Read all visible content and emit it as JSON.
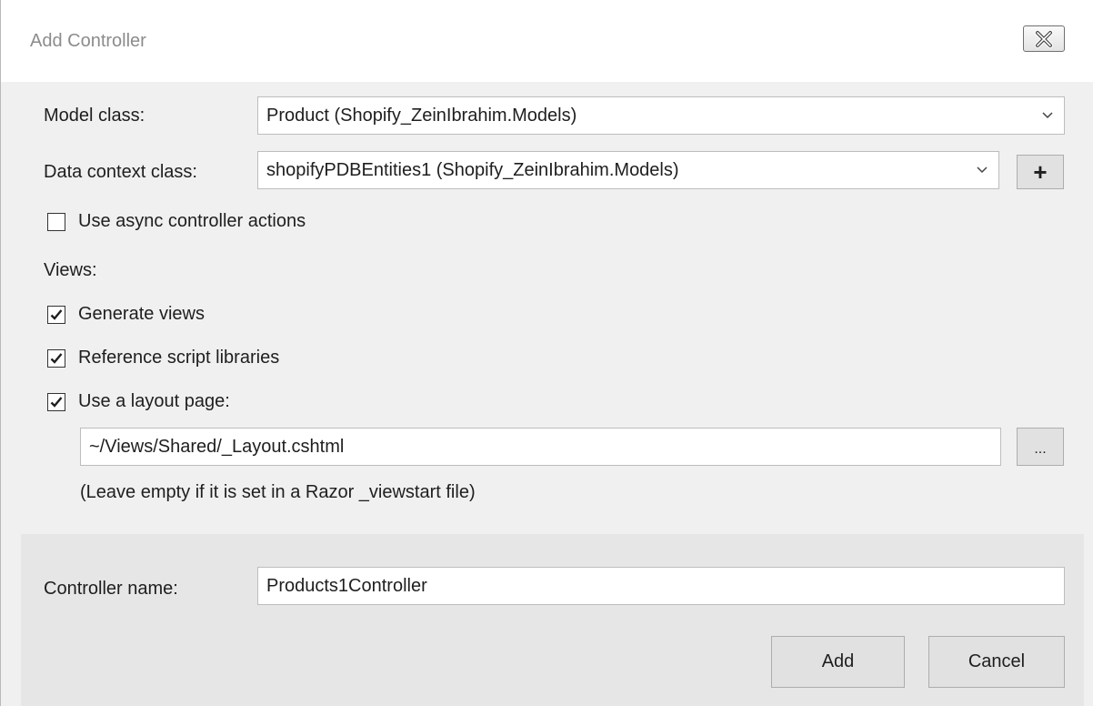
{
  "dialog": {
    "title": "Add Controller",
    "close_icon": "close-icon"
  },
  "model_class": {
    "label": "Model class:",
    "value": "Product (Shopify_ZeinIbrahim.Models)"
  },
  "data_context_class": {
    "label": "Data context class:",
    "value": "shopifyPDBEntities1 (Shopify_ZeinIbrahim.Models)",
    "add_button_label": "+"
  },
  "options": {
    "async_actions": {
      "label": "Use async controller actions",
      "checked": false
    }
  },
  "views": {
    "heading": "Views:",
    "generate_views": {
      "label": "Generate views",
      "checked": true
    },
    "reference_scripts": {
      "label": "Reference script libraries",
      "checked": true
    },
    "use_layout_page": {
      "label": "Use a layout page:",
      "checked": true
    },
    "layout_path": "~/Views/Shared/_Layout.cshtml",
    "browse_label": "...",
    "hint": "(Leave empty if it is set in a Razor _viewstart file)"
  },
  "controller": {
    "label": "Controller name:",
    "value": "Products1Controller"
  },
  "buttons": {
    "add": "Add",
    "cancel": "Cancel"
  },
  "colors": {
    "title_text": "#8c8c8c",
    "content_bg": "#f0f0f0",
    "footer_bg": "#e6e6e6"
  }
}
